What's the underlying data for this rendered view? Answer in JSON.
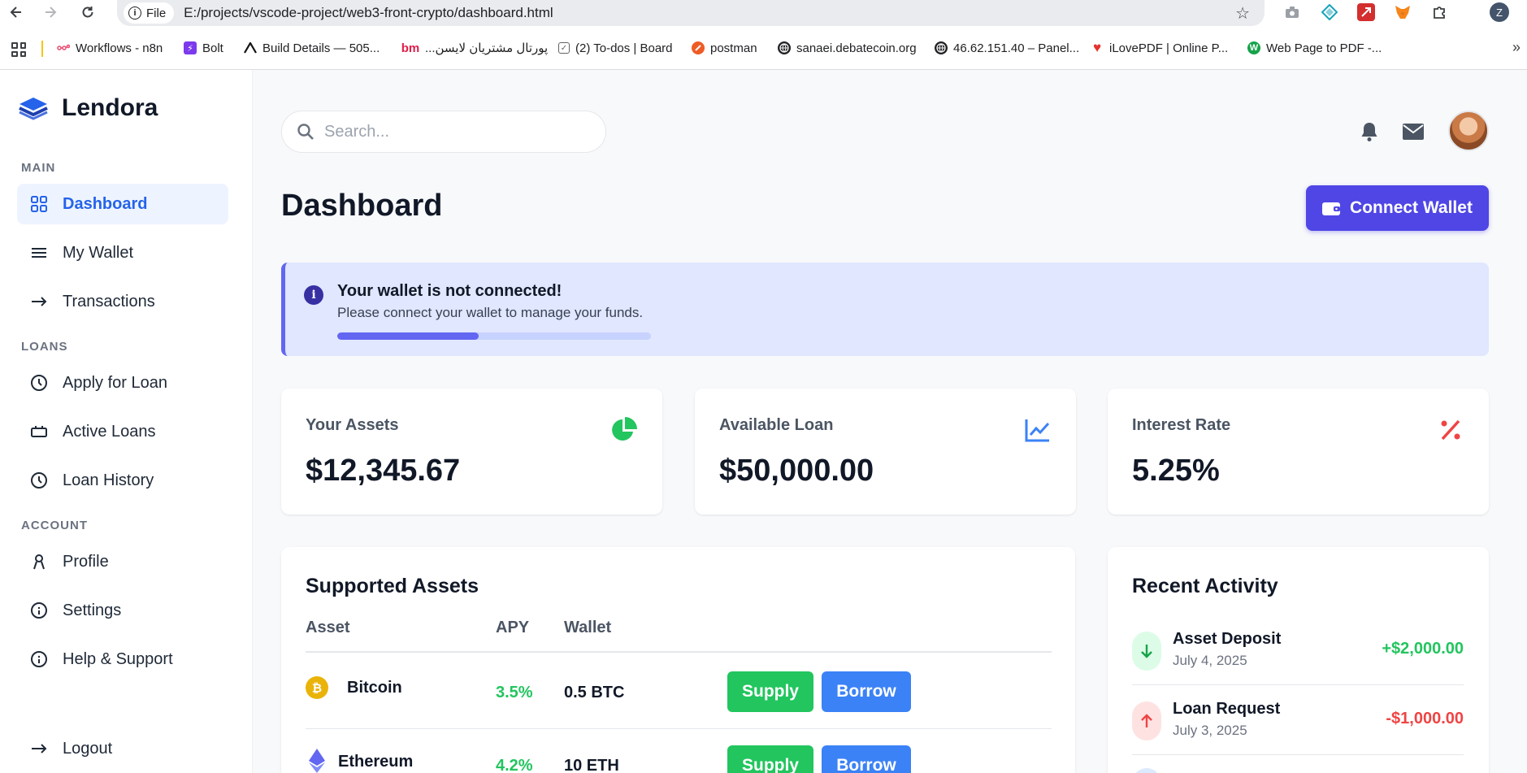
{
  "browser": {
    "site_chip": "File",
    "url": "E:/projects/vscode-project/web3-front-crypto/dashboard.html",
    "bookmarks": [
      {
        "label": "Workflows - n8n",
        "icon": "n8n-icon"
      },
      {
        "label": "Bolt",
        "icon": "bolt-icon"
      },
      {
        "label": "Build Details — 505...",
        "icon": "vercel-icon"
      },
      {
        "label": "پورتال مشتریان لایسن...",
        "icon": "bm-icon"
      },
      {
        "label": "(2) To-dos | Board",
        "icon": "checkbox-icon"
      },
      {
        "label": "postman",
        "icon": "postman-icon"
      },
      {
        "label": "sanaei.debatecoin.org",
        "icon": "globe-icon"
      },
      {
        "label": "46.62.151.40 – Panel...",
        "icon": "globe-icon"
      },
      {
        "label": "iLovePDF | Online P...",
        "icon": "heart-icon"
      },
      {
        "label": "Web Page to PDF -...",
        "icon": "w-icon"
      }
    ],
    "profile_initial": "Z"
  },
  "sidebar": {
    "brand": "Lendora",
    "sections": {
      "main": "MAIN",
      "loans": "LOANS",
      "account": "ACCOUNT"
    },
    "items": {
      "dashboard": "Dashboard",
      "wallet": "My Wallet",
      "transactions": "Transactions",
      "apply": "Apply for Loan",
      "active": "Active Loans",
      "history": "Loan History",
      "profile": "Profile",
      "settings": "Settings",
      "help": "Help & Support",
      "logout": "Logout"
    }
  },
  "header": {
    "search_placeholder": "Search...",
    "title": "Dashboard",
    "connect_label": "Connect Wallet"
  },
  "alert": {
    "title": "Your wallet is not connected!",
    "text": "Please connect your wallet to manage your funds.",
    "progress": 0.45
  },
  "stats": {
    "assets": {
      "label": "Your Assets",
      "value": "$12,345.67"
    },
    "loan": {
      "label": "Available Loan",
      "value": "$50,000.00"
    },
    "rate": {
      "label": "Interest Rate",
      "value": "5.25%"
    }
  },
  "supported": {
    "title": "Supported Assets",
    "columns": [
      "Asset",
      "APY",
      "Wallet"
    ],
    "rows": [
      {
        "name": "Bitcoin",
        "apy": "3.5%",
        "wallet": "0.5 BTC",
        "supply": "Supply",
        "borrow": "Borrow"
      },
      {
        "name": "Ethereum",
        "apy": "4.2%",
        "wallet": "10 ETH",
        "supply": "Supply",
        "borrow": "Borrow"
      }
    ]
  },
  "activity": {
    "title": "Recent Activity",
    "items": [
      {
        "title": "Asset Deposit",
        "date": "July 4, 2025",
        "amount": "+$2,000.00"
      },
      {
        "title": "Loan Request",
        "date": "July 3, 2025",
        "amount": "-$1,000.00"
      }
    ]
  },
  "colors": {
    "accent": "#4f46e5",
    "active_nav": "#2563eb",
    "positive": "#22c55e",
    "negative": "#ef4444",
    "borrow": "#3b82f6"
  }
}
